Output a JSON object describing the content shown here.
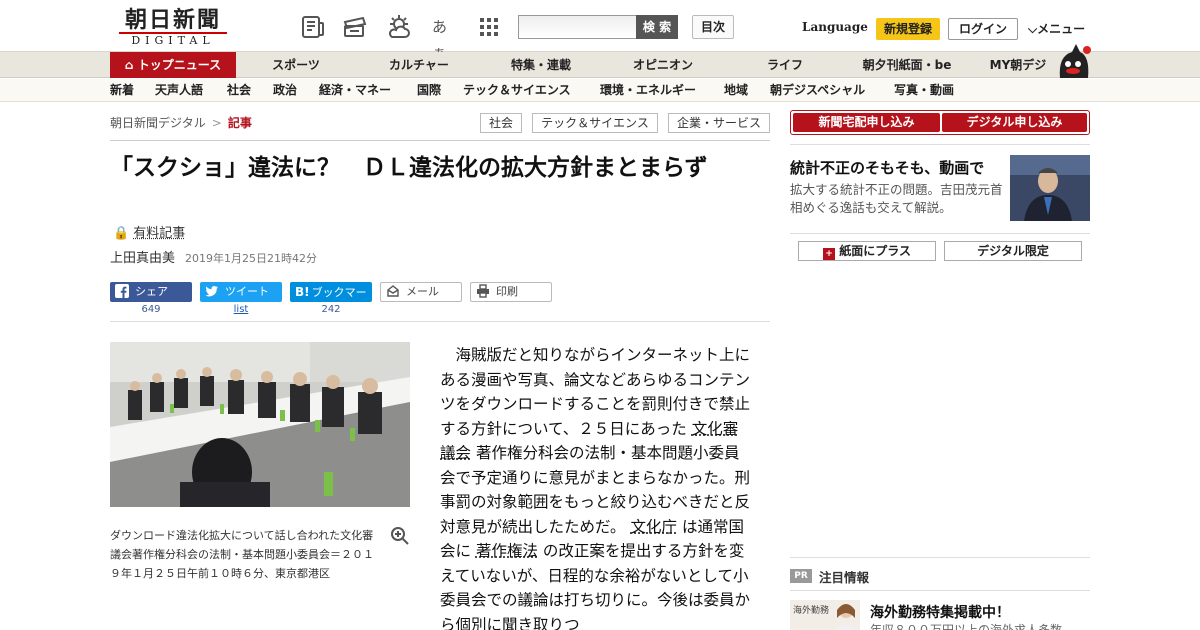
{
  "header": {
    "logo_jp": "朝日新聞",
    "logo_en": "DIGITAL",
    "icons": [
      "newspaper-icon",
      "ticket-icon",
      "weather-icon",
      "font-size-icon",
      "grid-menu-icon"
    ],
    "font_size_label": "あぁ",
    "search_button": "検 索",
    "search_placeholder": "",
    "toc_button": "目次",
    "language": "Language",
    "register": "新規登録",
    "login": "ログイン",
    "menu": "メニュー"
  },
  "category_nav": [
    "トップニュース",
    "スポーツ",
    "カルチャー",
    "特集・連載",
    "オピニオン",
    "ライフ",
    "朝夕刊紙面・be",
    "MY朝デジ"
  ],
  "sub_nav": [
    "新着",
    "天声人語",
    "社会",
    "政治",
    "経済・マネー",
    "国際",
    "テック＆サイエンス",
    "環境・エネルギー",
    "地域",
    "朝デジスペシャル",
    "写真・動画"
  ],
  "breadcrumb": {
    "root": "朝日新聞デジタル",
    "sep": ">",
    "current": "記事"
  },
  "tags": [
    "社会",
    "テック＆サイエンス",
    "企業・サービス"
  ],
  "article": {
    "title": "「スクショ」違法に？　ＤＬ違法化の拡大方針まとまらず",
    "paid_label": "有料記事",
    "author": "上田真由美",
    "date": "2019年1月25日21時42分",
    "body_parts": [
      "海賊版だと知りながらインターネット上にある漫画や写真、論文などあらゆるコンテンツをダウンロードすることを罰則付きで禁止する方針について、２５日にあった",
      "文化審議会",
      "著作権分科会の法制・基本問題小委員会で予定通りに意見がまとまらなかった。刑事罰の対象範囲をもっと絞り込むべきだと反対意見が続出したためだ。",
      "文化庁",
      "は通常国会に",
      "著作権法",
      "の改正案を提出する方針を変えていないが、日程的な余裕がないとして小委員会での議論は打ち切りに。今後は委員から個別に聞き取りつ"
    ],
    "photo_caption": "ダウンロード違法化拡大について話し合われた文化審議会著作権分科会の法制・基本問題小委員会＝２０１９年１月２５日午前１０時６分、東京都港区"
  },
  "share": {
    "facebook": "シェア",
    "facebook_count": "649",
    "twitter": "ツイート",
    "twitter_count": "list",
    "hatena": "ブックマーク",
    "hatena_count": "242",
    "mail": "メール",
    "print": "印刷"
  },
  "sidebar": {
    "subscribe_newspaper": "新聞宅配申し込み",
    "subscribe_digital": "デジタル申し込み",
    "promo_title": "統計不正のそもそも、動画で",
    "promo_desc": "拡大する統計不正の問題。吉田茂元首相めぐる逸話も交えて解説。",
    "plus_button": "紙面にプラス",
    "digital_only_button": "デジタル限定",
    "pr_badge": "PR",
    "pr_heading": "注目情報",
    "ad_title": "海外勤務特集掲載中！",
    "ad_sub": "年収８００万円以上の海外求人多数",
    "ad_thumb_text": "海外勤務"
  },
  "colors": {
    "brand_red": "#b5121b",
    "accent_yellow": "#f5c518",
    "facebook": "#3b5998",
    "twitter": "#1da1f2",
    "hatena": "#008fde"
  }
}
